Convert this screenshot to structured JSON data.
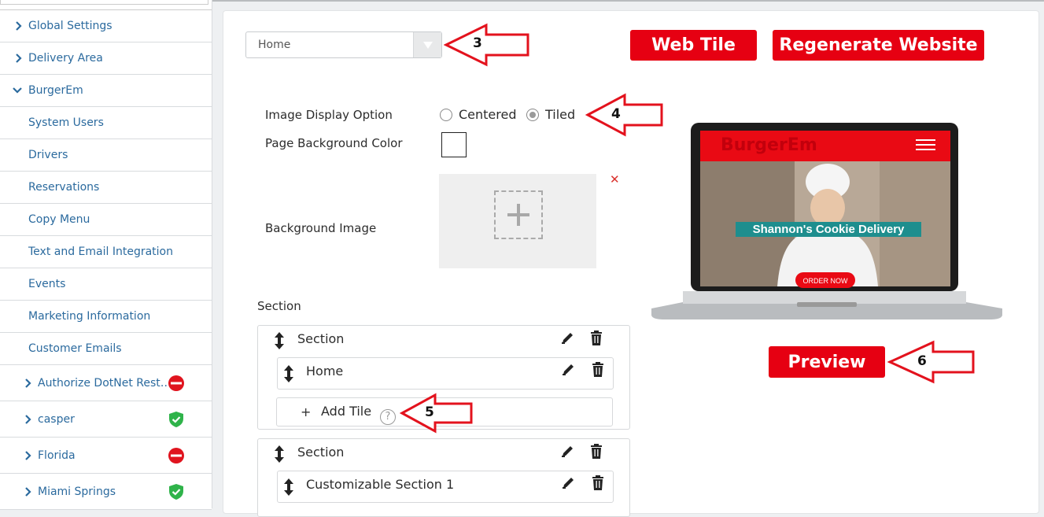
{
  "sidebar": {
    "items": [
      {
        "label": "Global Settings",
        "type": "collapsed"
      },
      {
        "label": "Delivery Area",
        "type": "collapsed"
      },
      {
        "label": "BurgerEm",
        "type": "expanded"
      },
      {
        "label": "System Users",
        "type": "sub"
      },
      {
        "label": "Drivers",
        "type": "sub"
      },
      {
        "label": "Reservations",
        "type": "sub"
      },
      {
        "label": "Copy Menu",
        "type": "sub"
      },
      {
        "label": "Text and Email Integration",
        "type": "sub"
      },
      {
        "label": "Events",
        "type": "sub"
      },
      {
        "label": "Marketing Information",
        "type": "sub"
      },
      {
        "label": "Customer Emails",
        "type": "sub"
      }
    ],
    "locations": [
      {
        "label": "Authorize DotNet Rest…",
        "status": "inactive",
        "status_color": "#e0141e"
      },
      {
        "label": "casper",
        "status": "active",
        "status_color": "#2fb34a"
      },
      {
        "label": "Florida",
        "status": "inactive",
        "status_color": "#e0141e"
      },
      {
        "label": "Miami Springs",
        "status": "active",
        "status_color": "#2fb34a"
      }
    ]
  },
  "page_select": {
    "value": "Home"
  },
  "buttons": {
    "web_tile": "Web Tile",
    "regenerate": "Regenerate Website",
    "preview": "Preview"
  },
  "callouts": {
    "c3": "3",
    "c4": "4",
    "c5": "5",
    "c6": "6"
  },
  "form": {
    "image_display_label": "Image Display Option",
    "option_centered": "Centered",
    "option_tiled": "Tiled",
    "selected_option": "Tiled",
    "bg_color_label": "Page Background Color",
    "bg_color_value": "#ffffff",
    "bg_image_label": "Background Image"
  },
  "sections_header": "Section",
  "sections": [
    {
      "title": "Section",
      "tiles": [
        {
          "title": "Home"
        }
      ],
      "add_tile": "Add Tile"
    },
    {
      "title": "Section",
      "tiles": [
        {
          "title": "Customizable Section 1"
        }
      ]
    }
  ],
  "preview": {
    "banner": "Shannon's Cookie Delivery",
    "order_button": "ORDER NOW",
    "logo_text": "BurgerEm"
  },
  "colors": {
    "accent": "#e60012",
    "link": "#2b6a9e"
  }
}
